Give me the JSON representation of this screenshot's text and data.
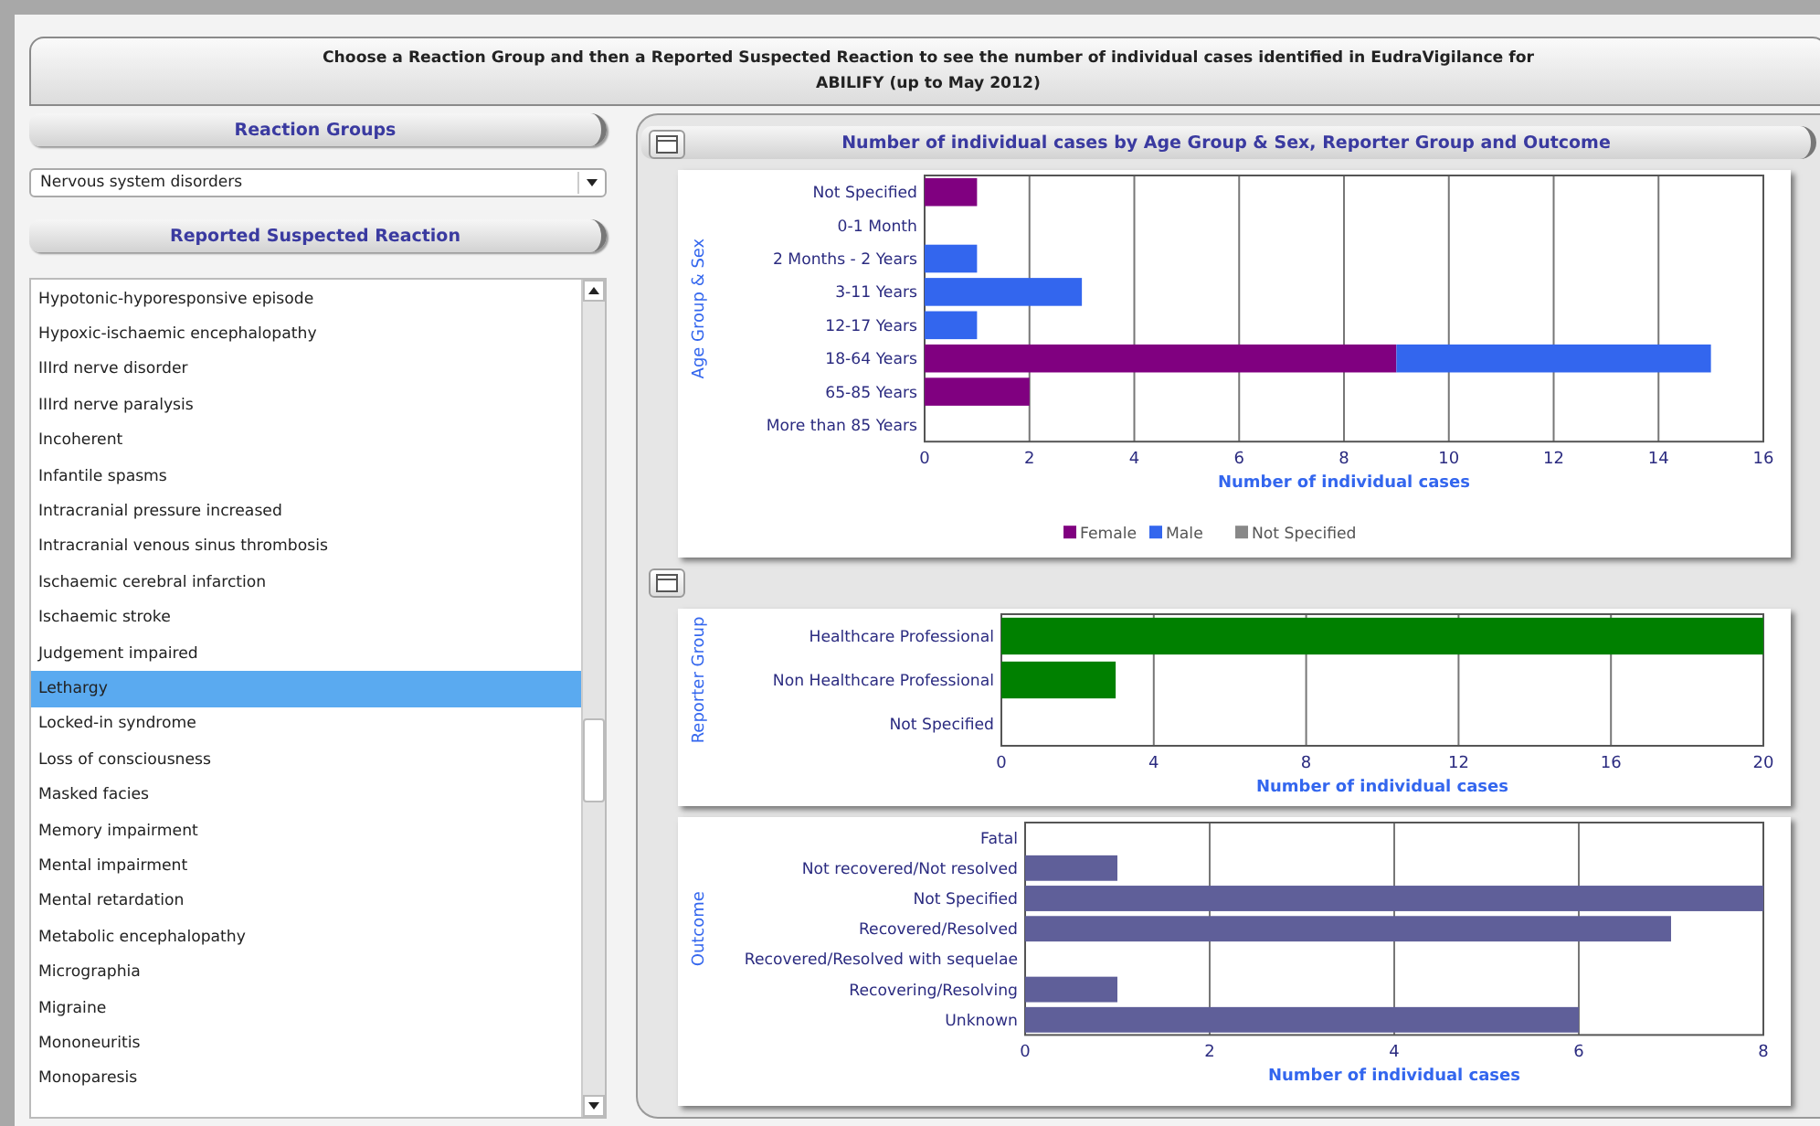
{
  "header": {
    "title_lines": [
      "Choose a Reaction Group and then a Reported Suspected Reaction to see the number of individual cases identified in EudraVigilance for",
      "ABILIFY (up to May 2012)"
    ]
  },
  "left": {
    "groups_title": "Reaction Groups",
    "group_select": {
      "value": "Nervous system disorders"
    },
    "reactions_title": "Reported Suspected Reaction",
    "reactions": [
      {
        "label": "Hypotonic-hyporesponsive episode",
        "selected": false
      },
      {
        "label": "Hypoxic-ischaemic encephalopathy",
        "selected": false
      },
      {
        "label": "IIIrd nerve disorder",
        "selected": false
      },
      {
        "label": "IIIrd nerve paralysis",
        "selected": false
      },
      {
        "label": "Incoherent",
        "selected": false
      },
      {
        "label": "Infantile spasms",
        "selected": false
      },
      {
        "label": "Intracranial pressure increased",
        "selected": false
      },
      {
        "label": "Intracranial venous sinus thrombosis",
        "selected": false
      },
      {
        "label": "Ischaemic cerebral infarction",
        "selected": false
      },
      {
        "label": "Ischaemic stroke",
        "selected": false
      },
      {
        "label": "Judgement impaired",
        "selected": false
      },
      {
        "label": "Lethargy",
        "selected": true
      },
      {
        "label": "Locked-in syndrome",
        "selected": false
      },
      {
        "label": "Loss of consciousness",
        "selected": false
      },
      {
        "label": "Masked facies",
        "selected": false
      },
      {
        "label": "Memory impairment",
        "selected": false
      },
      {
        "label": "Mental impairment",
        "selected": false
      },
      {
        "label": "Mental retardation",
        "selected": false
      },
      {
        "label": "Metabolic encephalopathy",
        "selected": false
      },
      {
        "label": "Micrographia",
        "selected": false
      },
      {
        "label": "Migraine",
        "selected": false
      },
      {
        "label": "Mononeuritis",
        "selected": false
      },
      {
        "label": "Monoparesis",
        "selected": false
      }
    ]
  },
  "right": {
    "title": "Number of individual cases by Age Group & Sex, Reporter Group and Outcome",
    "charts": [
      {
        "chart_data": {
          "type": "bar",
          "orientation": "horizontal",
          "stacked": true,
          "ylabel": "Age Group & Sex",
          "xlabel": "Number of individual cases",
          "categories": [
            "Not Specified",
            "0-1 Month",
            "2 Months - 2 Years",
            "3-11 Years",
            "12-17 Years",
            "18-64 Years",
            "65-85 Years",
            "More than 85 Years"
          ],
          "series": [
            {
              "name": "Female",
              "color": "#800080",
              "values": [
                1,
                0,
                0,
                0,
                0,
                9,
                2,
                0
              ]
            },
            {
              "name": "Male",
              "color": "#3366ee",
              "values": [
                0,
                0,
                1,
                3,
                1,
                6,
                0,
                0
              ]
            },
            {
              "name": "Not Specified",
              "color": "#888888",
              "values": [
                0,
                0,
                0,
                0,
                0,
                0,
                0,
                0
              ]
            }
          ],
          "xlim": [
            0,
            16
          ],
          "xticks": [
            0,
            2,
            4,
            6,
            8,
            10,
            12,
            14,
            16
          ],
          "grid": true,
          "legend": true
        }
      },
      {
        "chart_data": {
          "type": "bar",
          "orientation": "horizontal",
          "ylabel": "Reporter Group",
          "xlabel": "Number of individual cases",
          "categories": [
            "Healthcare Professional",
            "Non Healthcare Professional",
            "Not Specified"
          ],
          "series": [
            {
              "color": "#008000",
              "values": [
                20,
                3,
                0
              ]
            }
          ],
          "xlim": [
            0,
            20
          ],
          "xticks": [
            0,
            4,
            8,
            12,
            16,
            20
          ],
          "grid": true
        }
      },
      {
        "chart_data": {
          "type": "bar",
          "orientation": "horizontal",
          "ylabel": "Outcome",
          "xlabel": "Number of individual cases",
          "categories": [
            "Fatal",
            "Not recovered/Not resolved",
            "Not Specified",
            "Recovered/Resolved",
            "Recovered/Resolved with sequelae",
            "Recovering/Resolving",
            "Unknown"
          ],
          "series": [
            {
              "color": "#5f5f99",
              "values": [
                0,
                1,
                8,
                7,
                0,
                1,
                6
              ]
            }
          ],
          "xlim": [
            0,
            8
          ],
          "xticks": [
            0,
            2,
            4,
            6,
            8
          ],
          "grid": true
        }
      }
    ]
  }
}
